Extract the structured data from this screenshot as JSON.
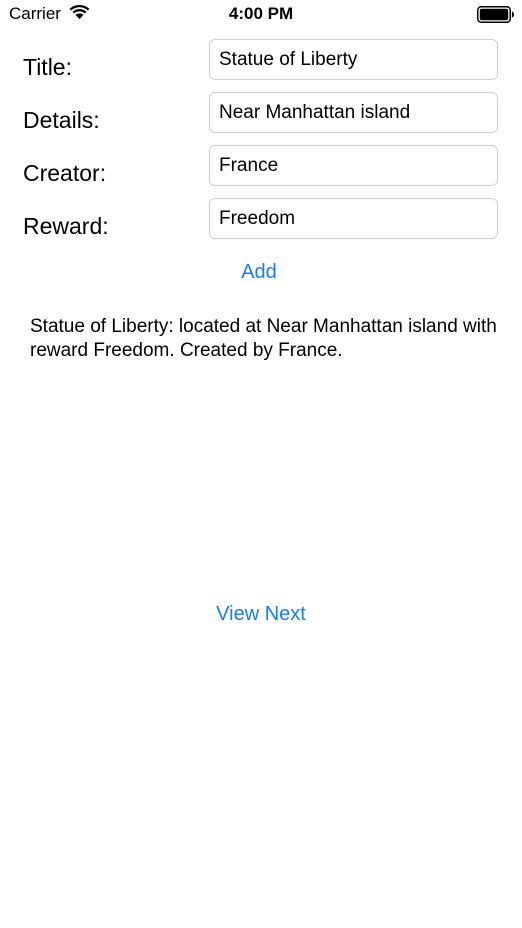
{
  "status_bar": {
    "carrier": "Carrier",
    "time": "4:00 PM",
    "icons": [
      "wifi-icon",
      "battery-icon"
    ]
  },
  "form": {
    "title_label": "Title:",
    "title_value": "Statue of Liberty",
    "details_label": "Details:",
    "details_value": "Near Manhattan island",
    "creator_label": "Creator:",
    "creator_value": "France",
    "reward_label": "Reward:",
    "reward_value": "Freedom"
  },
  "actions": {
    "add_label": "Add",
    "view_next_label": "View Next"
  },
  "summary": "Statue of Liberty: located at Near Manhattan island with reward Freedom. Created by France.",
  "colors": {
    "accent": "#1a7cf4",
    "field_border": "#cfcfcf",
    "text": "#000000",
    "background": "#ffffff"
  }
}
